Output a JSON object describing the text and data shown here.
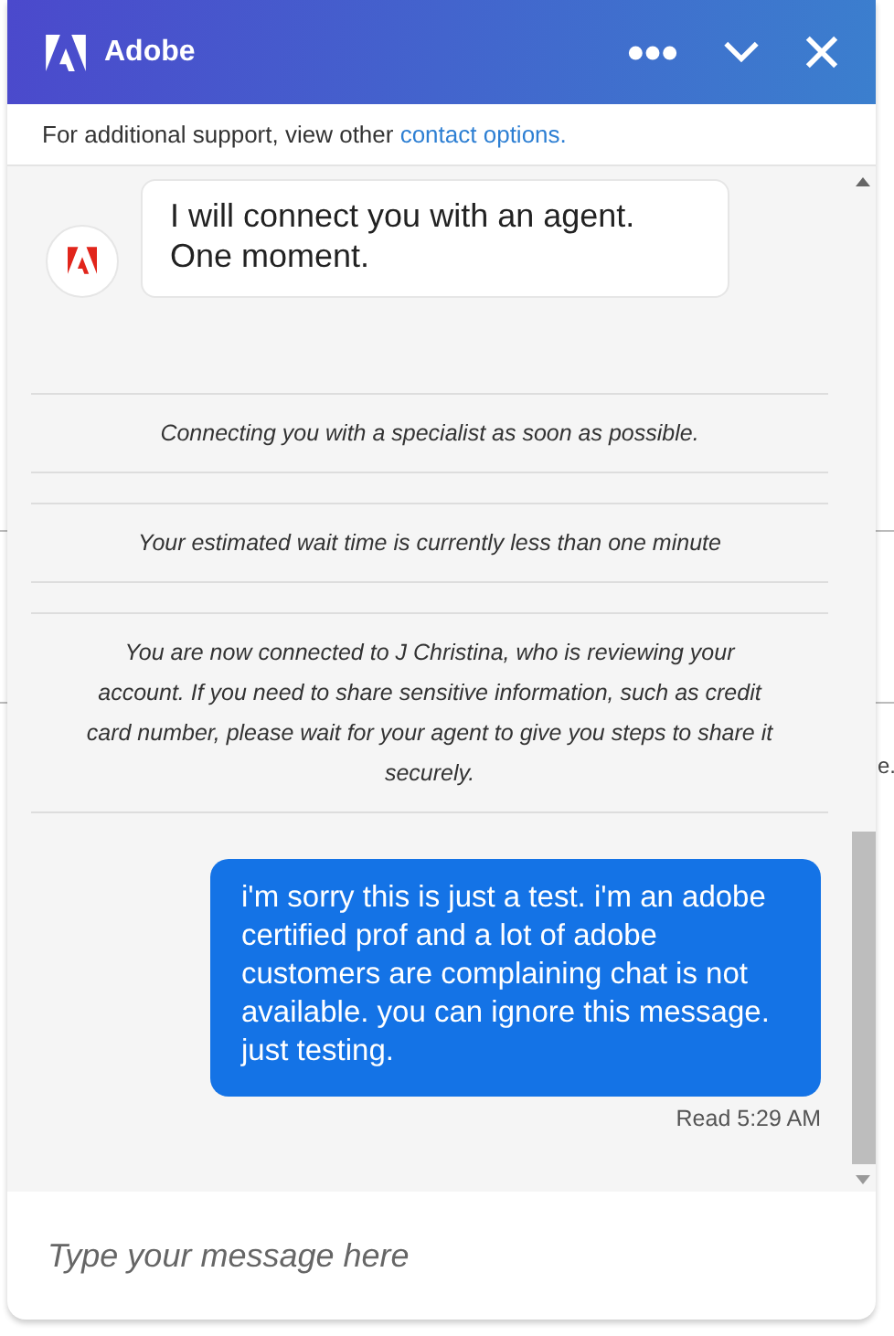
{
  "background_text": "e.",
  "header": {
    "title": "Adobe"
  },
  "support_note": {
    "text": "For additional support, view other ",
    "link": "contact options."
  },
  "messages": [
    {
      "kind": "bot",
      "text": "I will connect you with an agent. One moment."
    },
    {
      "kind": "system",
      "text": "Connecting you with a specialist as soon as possible."
    },
    {
      "kind": "system",
      "text": "Your estimated wait time is currently less than one minute"
    },
    {
      "kind": "system",
      "text": "You are now connected to J Christina, who is reviewing your account. If you need to share sensitive information, such as credit card number, please wait for your agent to give you steps to share it securely."
    },
    {
      "kind": "user",
      "text": "i'm sorry this is just a test.  i'm an adobe certified prof and a lot of adobe customers are complaining chat is not available.  you can ignore this message.  just testing.",
      "receipt": "Read 5:29 AM"
    }
  ],
  "composer": {
    "placeholder": "Type your message here"
  }
}
